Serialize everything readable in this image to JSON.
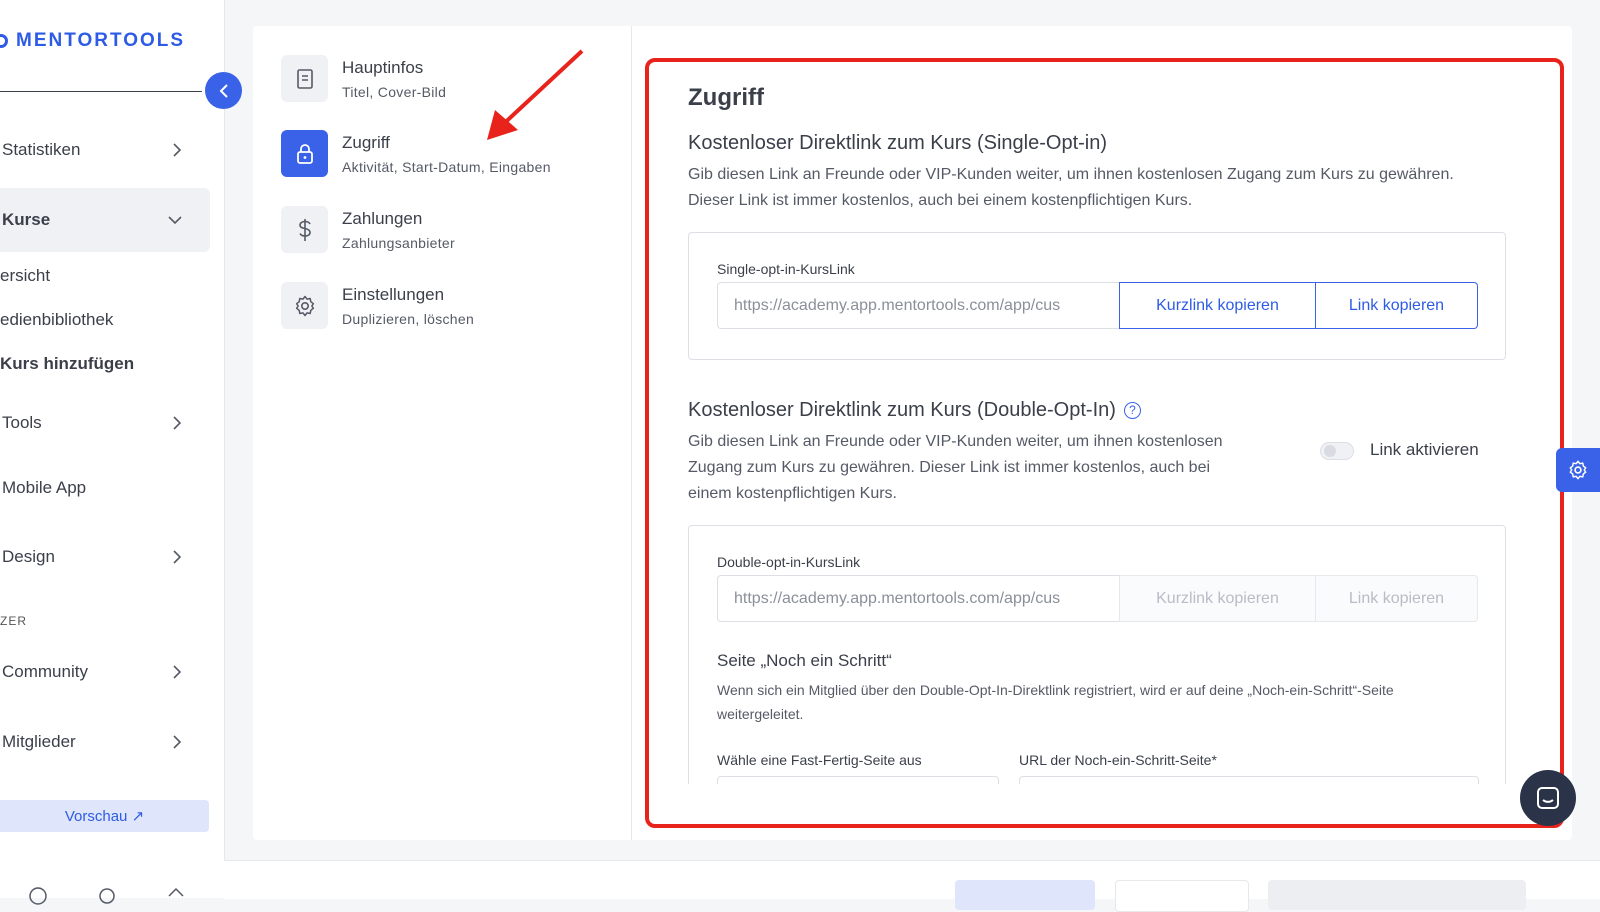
{
  "sidebar": {
    "logo_text": "MENTORTOOLS",
    "items": [
      {
        "label": "Statistiken"
      },
      {
        "label": "Kurse"
      },
      {
        "label": "Tools"
      },
      {
        "label": "Mobile App"
      },
      {
        "label": "Design"
      },
      {
        "label": "Community"
      },
      {
        "label": "Mitglieder"
      }
    ],
    "course_subitems": [
      "ersicht",
      "edienbibliothek",
      "Kurs hinzufügen"
    ],
    "section_caption": "ZER",
    "preview_label": "Vorschau ↗"
  },
  "subnav": {
    "items": [
      {
        "title": "Hauptinfos",
        "subtitle": "Titel, Cover-Bild",
        "icon": "book-icon"
      },
      {
        "title": "Zugriff",
        "subtitle": "Aktivität, Start-Datum, Eingaben",
        "icon": "lock-icon"
      },
      {
        "title": "Zahlungen",
        "subtitle": "Zahlungsanbieter",
        "icon": "dollar-icon"
      },
      {
        "title": "Einstellungen",
        "subtitle": "Duplizieren, löschen",
        "icon": "gear-icon"
      }
    ]
  },
  "content": {
    "title": "Zugriff",
    "single": {
      "title": "Kostenloser Direktlink zum Kurs (Single-Opt-in)",
      "description": "Gib diesen Link an Freunde oder VIP-Kunden weiter, um ihnen kostenlosen Zugang zum Kurs zu gewähren. Dieser Link ist immer kostenlos, auch bei einem kostenpflichtigen Kurs.",
      "field_label": "Single-opt-in-KursLink",
      "url": "https://academy.app.mentortools.com/app/cus",
      "short_button": "Kurzlink kopieren",
      "link_button": "Link kopieren"
    },
    "double": {
      "title": "Kostenloser Direktlink zum Kurs (Double-Opt-In)",
      "description": "Gib diesen Link an Freunde oder VIP-Kunden weiter, um ihnen kostenlosen Zugang zum Kurs zu gewähren. Dieser Link ist immer kostenlos, auch bei einem kostenpflichtigen Kurs.",
      "toggle_label": "Link aktivieren",
      "toggle_on": false,
      "field_label": "Double-opt-in-KursLink",
      "url": "https://academy.app.mentortools.com/app/cus",
      "short_button": "Kurzlink kopieren",
      "link_button": "Link kopieren",
      "step_title": "Seite „Noch ein Schritt“",
      "step_description": "Wenn sich ein Mitglied über den Double-Opt-In-Direktlink registriert, wird er auf deine „Noch-ein-Schritt“-Seite weitergeleitet.",
      "select_label": "Wähle eine Fast-Fertig-Seite aus",
      "url_label": "URL der Noch-ein-Schritt-Seite*"
    }
  },
  "colors": {
    "accent": "#3a62e8",
    "highlight": "#e8231c"
  }
}
